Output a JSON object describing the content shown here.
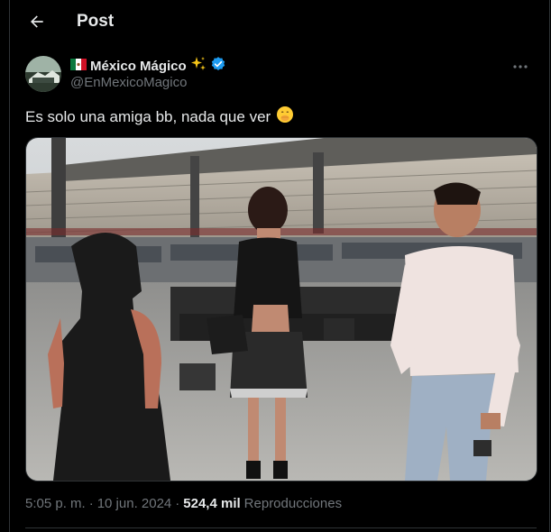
{
  "header": {
    "title": "Post"
  },
  "author": {
    "flag_icon": "mexico-flag-icon",
    "display_name": "México Mágico",
    "sparkle_icon": "sparkles-icon",
    "verified_icon": "verified-badge-icon",
    "handle": "@EnMexicoMagico",
    "badge_color": "#1d9bf0"
  },
  "post": {
    "text": "Es solo una amiga bb, nada que ver",
    "emoji_icon": "face-with-hand-over-mouth-icon",
    "image_alt": "photo"
  },
  "meta": {
    "time": "5:05 p. m.",
    "separator": "·",
    "date": "10 jun. 2024",
    "views_count": "524,4 mil",
    "views_label": "Reproducciones"
  },
  "colors": {
    "background": "#000000",
    "text_primary": "#e7e9ea",
    "text_secondary": "#71767b",
    "border": "#2f3336"
  }
}
